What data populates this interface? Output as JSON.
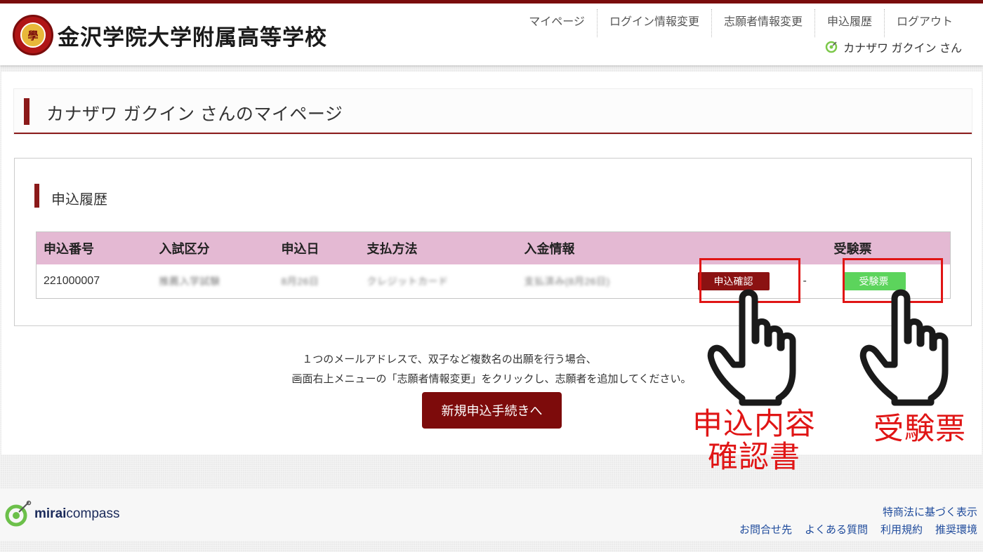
{
  "header": {
    "school_name": "金沢学院大学附属高等学校",
    "seal_char": "學",
    "nav": [
      "マイページ",
      "ログイン情報変更",
      "志願者情報変更",
      "申込履歴",
      "ログアウト"
    ],
    "user_greeting": "カナザワ ガクイン さん"
  },
  "page": {
    "title": "カナザワ ガクイン さんのマイページ"
  },
  "history": {
    "section_title": "申込履歴",
    "columns": [
      "申込番号",
      "入試区分",
      "申込日",
      "支払方法",
      "入金情報",
      "",
      "",
      "受験票"
    ],
    "row": {
      "number": "221000007",
      "exam_type": "推薦入学試験",
      "date": "8月26日",
      "payment": "クレジットカード",
      "deposit": "支払済み(8月26日)",
      "confirm_label": "申込確認",
      "dash": "-",
      "ticket_label": "受験票"
    }
  },
  "notice": {
    "line1": "１つのメールアドレスで、双子など複数名の出願を行う場合、",
    "line2": "画面右上メニューの「志願者情報変更」をクリックし、志願者を追加してください。"
  },
  "new_application_label": "新規申込手続きへ",
  "annotations": {
    "confirm_line1": "申込内容",
    "confirm_line2": "確認書",
    "ticket": "受験票"
  },
  "footer": {
    "brand_bold": "mirai",
    "brand_regular": "compass",
    "link_law": "特商法に基づく表示",
    "links": [
      "お問合せ先",
      "よくある質問",
      "利用規約",
      "推奨環境"
    ]
  },
  "colors": {
    "brand": "#7a0c0c",
    "table_header": "#e4b9d3",
    "ticket_button": "#5cd45c",
    "annotation_red": "#e01515"
  }
}
